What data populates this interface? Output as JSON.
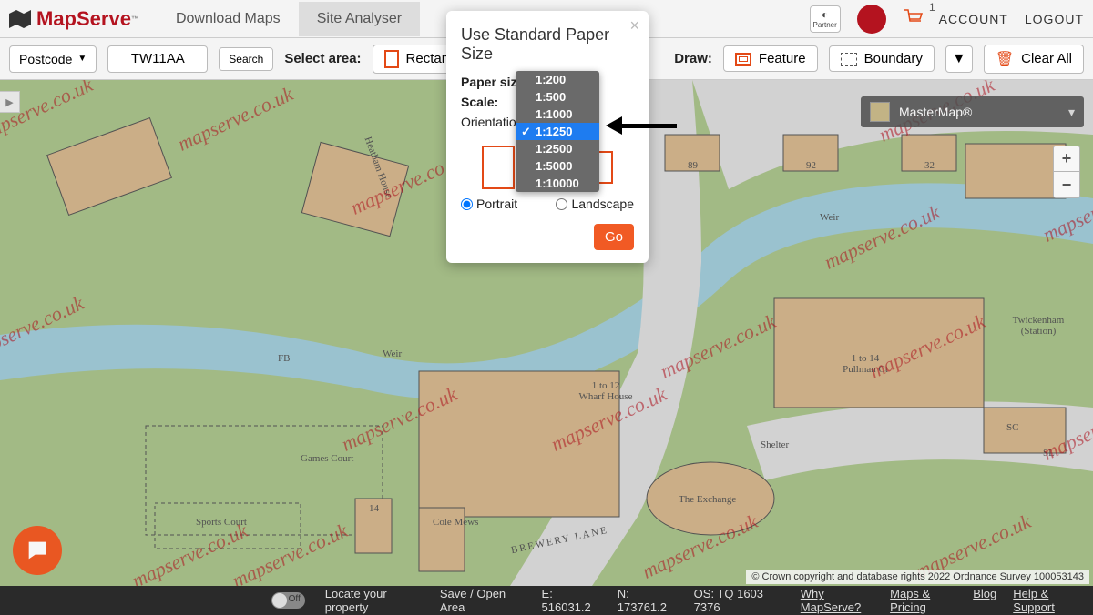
{
  "brand": {
    "name": "MapServe",
    "tm": "™"
  },
  "nav": {
    "download": "Download Maps",
    "analyser": "Site Analyser"
  },
  "topright": {
    "partner": "Partner",
    "basket_count": "1",
    "account": "ACCOUNT",
    "logout": "LOGOUT"
  },
  "toolbar": {
    "postcode_label": "Postcode",
    "postcode_value": "TW11AA",
    "search": "Search",
    "select_area": "Select area:",
    "rectangle": "Rectangle",
    "draw": "Draw:",
    "feature": "Feature",
    "boundary": "Boundary",
    "clear_all": "Clear All"
  },
  "layer": {
    "name": "MasterMap®"
  },
  "modal": {
    "title": "Use Standard Paper Size",
    "paper_size": "Paper size:",
    "scale": "Scale:",
    "orientation": "Orientation",
    "portrait": "Portrait",
    "landscape": "Landscape",
    "go": "Go",
    "close": "×"
  },
  "scale_options": [
    "1:200",
    "1:500",
    "1:1000",
    "1:1250",
    "1:2500",
    "1:5000",
    "1:10000"
  ],
  "scale_selected": "1:1250",
  "map_labels": {
    "heatham": "Heatham House",
    "fb": "FB",
    "weir": "Weir",
    "weir2": "Weir",
    "games": "Games Court",
    "sports": "Sports Court",
    "cole": "Cole Mews",
    "wharf": "1 to 12 Wharf House",
    "shelter": "Shelter",
    "exchange": "The Exchange",
    "brewery": "BREWERY LANE",
    "twick": "Twickenham (Station)",
    "pullman": "1 to 14 Pullman Ct",
    "n89": "89",
    "n92": "92",
    "n32": "32",
    "n14": "14",
    "sl": "SL",
    "sc": "SC"
  },
  "watermark": "mapserve.co.uk",
  "attribution": "© Crown copyright and database rights 2022 Ordnance Survey 100053143",
  "footer": {
    "off": "Off",
    "locate": "Locate your property",
    "save": "Save / Open Area",
    "e": "E: 516031.2",
    "n": "N: 173761.2",
    "os": "OS: TQ 1603 7376",
    "why": "Why MapServe?",
    "pricing": "Maps & Pricing",
    "blog": "Blog",
    "help": "Help & Support"
  }
}
